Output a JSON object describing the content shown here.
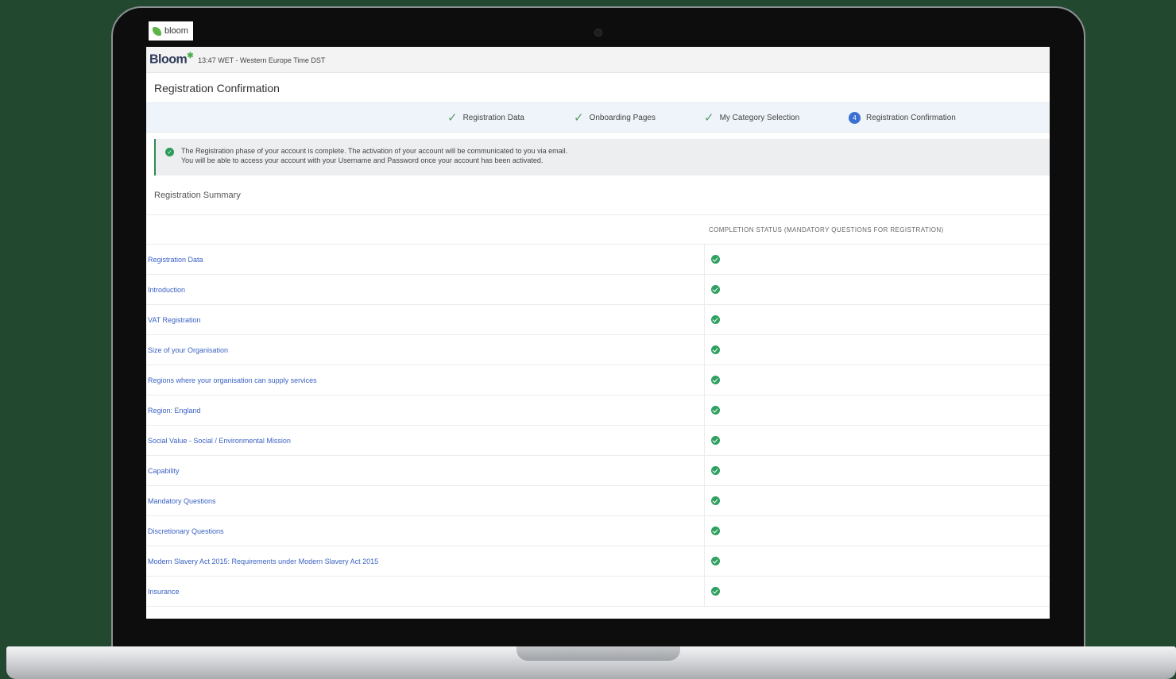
{
  "browser_tab": {
    "label": "bloom"
  },
  "header": {
    "logo": "Bloom",
    "clock": "13:47 WET - Western Europe Time DST"
  },
  "page": {
    "title": "Registration Confirmation"
  },
  "stepper": {
    "steps": [
      {
        "label": "Registration Data",
        "state": "done"
      },
      {
        "label": "Onboarding Pages",
        "state": "done"
      },
      {
        "label": "My Category Selection",
        "state": "done"
      },
      {
        "label": "Registration Confirmation",
        "state": "current",
        "number": "4"
      }
    ]
  },
  "alert": {
    "line1": "The Registration phase of your account is complete. The activation of your account will be communicated to you via email.",
    "line2": "You will be able to access your account with your Username and Password once your account has been activated."
  },
  "summary": {
    "title": "Registration Summary",
    "column_header": "COMPLETION STATUS (MANDATORY QUESTIONS FOR REGISTRATION)",
    "rows": [
      {
        "label": "Registration Data",
        "complete": true
      },
      {
        "label": "Introduction",
        "complete": true
      },
      {
        "label": "VAT Registration",
        "complete": true
      },
      {
        "label": "Size of your Organisation",
        "complete": true
      },
      {
        "label": "Regions where your organisation can supply services",
        "complete": true
      },
      {
        "label": "Region: England",
        "complete": true
      },
      {
        "label": "Social Value - Social / Environmental Mission",
        "complete": true
      },
      {
        "label": "Capability",
        "complete": true
      },
      {
        "label": "Mandatory Questions",
        "complete": true
      },
      {
        "label": "Discretionary Questions",
        "complete": true
      },
      {
        "label": "Modern Slavery Act 2015: Requirements under Modern Slavery Act 2015",
        "complete": true
      },
      {
        "label": "Insurance",
        "complete": true
      }
    ]
  },
  "colors": {
    "accent": "#3b6fd4",
    "success": "#2ea05f",
    "link": "#3a62c2",
    "background": "#234830"
  }
}
